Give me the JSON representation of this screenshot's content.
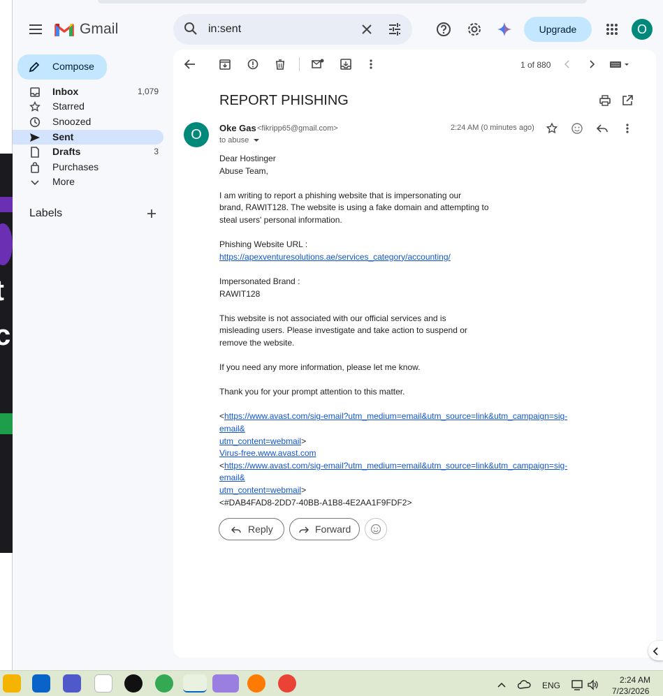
{
  "app": {
    "name": "Gmail"
  },
  "search": {
    "value": "in:sent"
  },
  "header": {
    "upgrade_label": "Upgrade",
    "avatar_letter": "O"
  },
  "sidebar": {
    "compose_label": "Compose",
    "items": [
      {
        "label": "Inbox",
        "count": "1,079",
        "icon": "inbox-icon"
      },
      {
        "label": "Starred",
        "count": "",
        "icon": "star-icon"
      },
      {
        "label": "Snoozed",
        "count": "",
        "icon": "clock-icon"
      },
      {
        "label": "Sent",
        "count": "",
        "icon": "send-icon"
      },
      {
        "label": "Drafts",
        "count": "3",
        "icon": "draft-icon"
      },
      {
        "label": "Purchases",
        "count": "",
        "icon": "shopping-bag-icon"
      },
      {
        "label": "More",
        "count": "",
        "icon": "chevron-down-icon"
      }
    ],
    "labels_title": "Labels"
  },
  "toolbar": {
    "page_count": "1 of 880"
  },
  "email": {
    "subject": "REPORT PHISHING",
    "sender_initial": "O",
    "sender_name": "Oke Gas",
    "sender_email": "<fikripp65@gmail.com>",
    "to": "to abuse",
    "time": "2:24 AM (0 minutes ago)",
    "body": {
      "greeting_1": "Dear Hostinger",
      "greeting_2": "Abuse Team,",
      "para1_l1": "I am writing to report a phishing website that is impersonating our",
      "para1_l2": "brand, RAWIT128. The website is using a fake domain and attempting to",
      "para1_l3": "steal users' personal information.",
      "url_label": "Phishing Website URL :",
      "url": "https://apexventuresolutions.ae/services_category/accounting/",
      "brand_label": "Impersonated Brand :",
      "brand": "RAWIT128",
      "para2_l1": "This website is not associated with our official services and is",
      "para2_l2": "misleading users. Please investigate and take action to suspend or",
      "para2_l3": "remove the website.",
      "para3": "If you need any more information, please let me know.",
      "para4": "Thank you for your prompt attention to this matter.",
      "sig_link1_a": "https://www.avast.com/sig-email?utm_medium=email&utm_source=link&utm_campaign=sig-email&",
      "sig_link1_b": "utm_content=webmail",
      "sig_virusfree": "Virus-free.www.avast.com",
      "sig_link2_a": "https://www.avast.com/sig-email?utm_medium=email&utm_source=link&utm_campaign=sig-email&",
      "sig_link2_b": "utm_content=webmail",
      "sig_id": "<#DAB4FAD8-2DD7-40BB-A1B8-4E2AA1F9FDF2>"
    },
    "reply_label": "Reply",
    "forward_label": "Forward"
  },
  "taskbar": {
    "lang": "ENG",
    "time": "2:24 AM",
    "date": "7/23/2026"
  },
  "colors": {
    "accent": "#c2e7ff",
    "selected_nav": "#d3e3fd",
    "avatar": "#00897b",
    "link": "#1155cc"
  }
}
